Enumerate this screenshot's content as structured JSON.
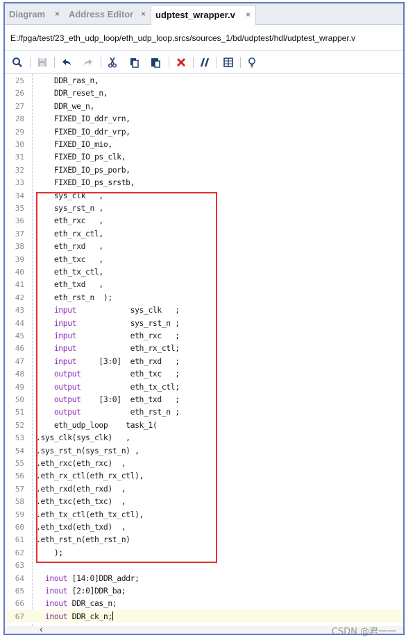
{
  "tabs": [
    {
      "label": "Diagram",
      "active": false
    },
    {
      "label": "Address Editor",
      "active": false
    },
    {
      "label": "udptest_wrapper.v",
      "active": true
    }
  ],
  "close_glyph": "×",
  "file_path": "E:/fpga/test/23_eth_udp_loop/eth_udp_loop.srcs/sources_1/bd/udptest/hdl/udptest_wrapper.v",
  "toolbar_icons": [
    "search-icon",
    "save-icon",
    "undo-icon",
    "redo-icon",
    "cut-icon",
    "copy-icon",
    "paste-icon",
    "delete-icon",
    "comment-icon",
    "columns-icon",
    "bulb-icon"
  ],
  "code_lines": [
    {
      "n": "25",
      "text": "    DDR_ras_n,"
    },
    {
      "n": "26",
      "text": "    DDR_reset_n,"
    },
    {
      "n": "27",
      "text": "    DDR_we_n,"
    },
    {
      "n": "28",
      "text": "    FIXED_IO_ddr_vrn,"
    },
    {
      "n": "29",
      "text": "    FIXED_IO_ddr_vrp,"
    },
    {
      "n": "30",
      "text": "    FIXED_IO_mio,"
    },
    {
      "n": "31",
      "text": "    FIXED_IO_ps_clk,"
    },
    {
      "n": "32",
      "text": "    FIXED_IO_ps_porb,"
    },
    {
      "n": "33",
      "text": "    FIXED_IO_ps_srstb,"
    },
    {
      "n": "34",
      "text": "    sys_clk   ,"
    },
    {
      "n": "35",
      "text": "    sys_rst_n ,"
    },
    {
      "n": "36",
      "text": "    eth_rxc   ,"
    },
    {
      "n": "37",
      "text": "    eth_rx_ctl,"
    },
    {
      "n": "38",
      "text": "    eth_rxd   ,"
    },
    {
      "n": "39",
      "text": "    eth_txc   ,"
    },
    {
      "n": "40",
      "text": "    eth_tx_ctl,"
    },
    {
      "n": "41",
      "text": "    eth_txd   ,"
    },
    {
      "n": "42",
      "text": "    eth_rst_n  );"
    },
    {
      "n": "43",
      "kw": "input",
      "pre": "    ",
      "post": "            sys_clk   ;"
    },
    {
      "n": "44",
      "kw": "input",
      "pre": "    ",
      "post": "            sys_rst_n ;"
    },
    {
      "n": "45",
      "kw": "input",
      "pre": "    ",
      "post": "            eth_rxc   ;"
    },
    {
      "n": "46",
      "kw": "input",
      "pre": "    ",
      "post": "            eth_rx_ctl;"
    },
    {
      "n": "47",
      "kw": "input",
      "pre": "    ",
      "post": "     [3:0]  eth_rxd   ;"
    },
    {
      "n": "48",
      "kw": "output",
      "pre": "    ",
      "post": "           eth_txc   ;"
    },
    {
      "n": "49",
      "kw": "output",
      "pre": "    ",
      "post": "           eth_tx_ctl;"
    },
    {
      "n": "50",
      "kw": "output",
      "pre": "    ",
      "post": "    [3:0]  eth_txd   ;"
    },
    {
      "n": "51",
      "kw": "output",
      "pre": "    ",
      "post": "           eth_rst_n ;"
    },
    {
      "n": "52",
      "text": "    eth_udp_loop    task_1("
    },
    {
      "n": "53",
      "text": ".sys_clk(sys_clk)   ,"
    },
    {
      "n": "54",
      "text": ".sys_rst_n(sys_rst_n) ,"
    },
    {
      "n": "55",
      "text": ".eth_rxc(eth_rxc)  ,"
    },
    {
      "n": "56",
      "text": ".eth_rx_ctl(eth_rx_ctl),"
    },
    {
      "n": "57",
      "text": ".eth_rxd(eth_rxd)  ,"
    },
    {
      "n": "58",
      "text": ".eth_txc(eth_txc)  ,"
    },
    {
      "n": "59",
      "text": ".eth_tx_ctl(eth_tx_ctl),"
    },
    {
      "n": "60",
      "text": ".eth_txd(eth_txd)  ,"
    },
    {
      "n": "61",
      "text": ".eth_rst_n(eth_rst_n)"
    },
    {
      "n": "62",
      "text": "    );"
    },
    {
      "n": "63",
      "text": ""
    },
    {
      "n": "64",
      "kw": "inout",
      "pre": "  ",
      "post": " [14:0]DDR_addr;"
    },
    {
      "n": "65",
      "kw": "inout",
      "pre": "  ",
      "post": " [2:0]DDR_ba;"
    },
    {
      "n": "66",
      "kw": "inout",
      "pre": "  ",
      "post": " DDR_cas_n;"
    },
    {
      "n": "67",
      "kw": "inout",
      "pre": "  ",
      "post": " DDR_ck_n;",
      "current": true
    }
  ],
  "scroll_left_glyph": "‹",
  "watermark": "CSDN @君一一",
  "colors": {
    "keyword": "#8c2fb8",
    "highlight_box": "#e03232",
    "current_line": "#fcfbe3"
  }
}
